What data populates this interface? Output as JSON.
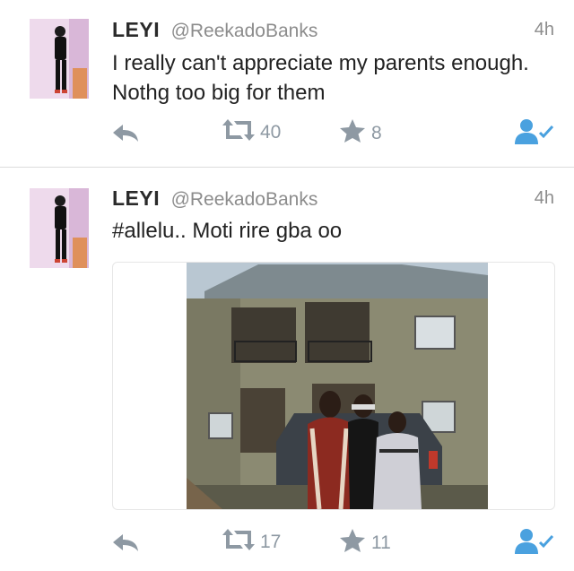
{
  "tweets": [
    {
      "name": "LEYI",
      "handle": "@ReekadoBanks",
      "time": "4h",
      "text": "I really can't appreciate my parents enough. Nothg too big for them",
      "retweets": "40",
      "favorites": "8"
    },
    {
      "name": "LEYI",
      "handle": "@ReekadoBanks",
      "time": "4h",
      "text": "#allelu.. Moti rire gba oo",
      "retweets": "17",
      "favorites": "11",
      "media": {
        "image": "photo of a family of three standing in front of a two-storey house with a parked car"
      }
    }
  ],
  "icons": {
    "reply": "reply-icon",
    "retweet": "retweet-icon",
    "favorite": "star-icon",
    "follow": "follow-user-icon"
  },
  "colors": {
    "icon_gray": "#8e99a3",
    "follow_blue": "#4aa1df",
    "text": "#222222",
    "meta": "#8c8c8c"
  }
}
